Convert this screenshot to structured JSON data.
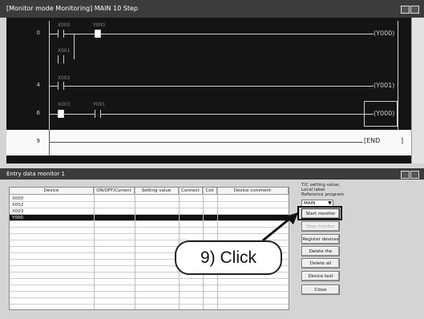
{
  "top_window": {
    "title": "[Monitor mode Monitoring]  MAIN  10 Step",
    "steps": [
      "0",
      "4",
      "6",
      "9"
    ],
    "labels": [
      "X000",
      "Y000",
      "X001",
      "X002",
      "X003",
      "Y001"
    ],
    "coils": [
      "(Y000)",
      "(Y001)",
      "(Y000)"
    ],
    "end_label": "END"
  },
  "bottom_window": {
    "title": "Entry data monitor 1",
    "columns": [
      "Device",
      "ON/OFF/Current",
      "Setting value",
      "Connect",
      "Coil",
      "Device comment"
    ],
    "rows": [
      "X000",
      "X002",
      "X003",
      "Y000",
      "",
      "",
      "",
      "",
      "",
      "",
      "",
      "",
      "",
      "",
      "",
      "",
      ""
    ],
    "side_text": [
      "T/C setting value,",
      "Local label",
      "Reference program"
    ],
    "program_select": "MAIN",
    "buttons": {
      "start_monitor": "Start monitor",
      "stop_monitor": "Stop monitor",
      "register_devices": "Register devices",
      "delete_device": "Delete the device",
      "delete_all": "Delete all devices",
      "device_test": "Device test",
      "close": "Close"
    }
  },
  "annotation": {
    "callout_text": "9) Click"
  }
}
